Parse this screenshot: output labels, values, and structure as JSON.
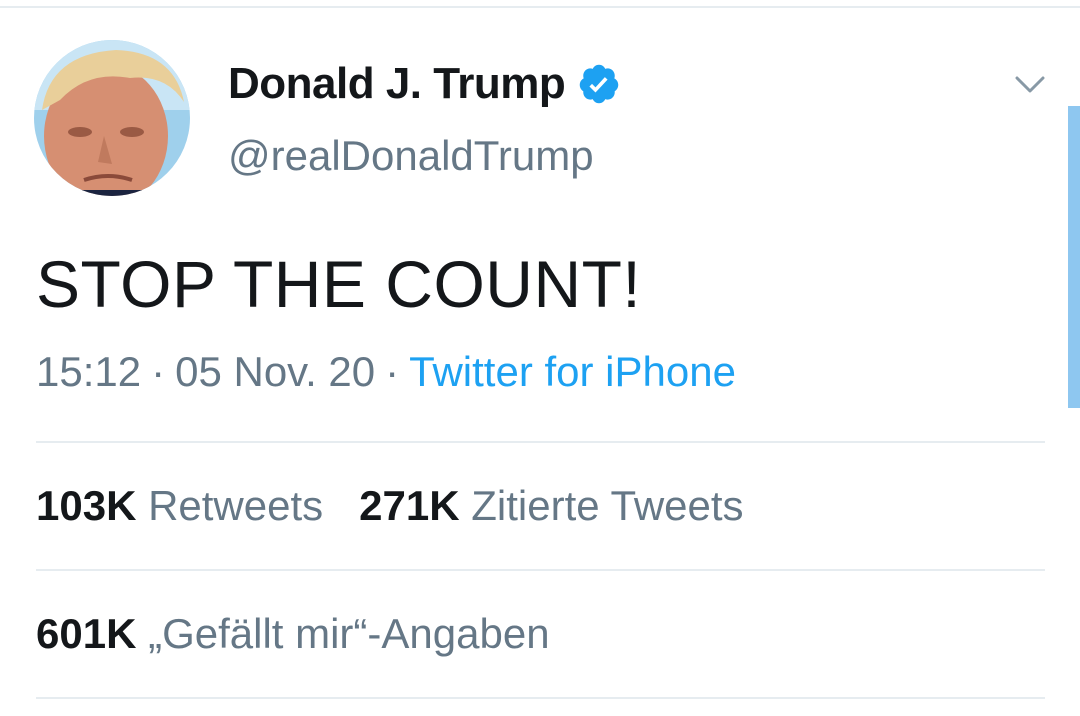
{
  "tweet": {
    "author": {
      "display_name": "Donald J. Trump",
      "handle": "@realDonaldTrump",
      "verified": true,
      "avatar_icon": "user-avatar"
    },
    "text": "STOP THE COUNT!",
    "time": "15:12",
    "date": "05 Nov. 20",
    "separator": "·",
    "source": "Twitter for iPhone",
    "stats": {
      "retweets_count": "103K",
      "retweets_label": "Retweets",
      "quotes_count": "271K",
      "quotes_label": "Zitierte Tweets",
      "likes_count": "601K",
      "likes_label": "„Gefällt mir“-Angaben"
    }
  },
  "icons": {
    "verified": "verified-badge-icon",
    "more": "chevron-down-icon"
  },
  "colors": {
    "text_primary": "#14171a",
    "text_secondary": "#657786",
    "link": "#1da1f2",
    "verified": "#1da1f2",
    "divider": "#e6ecf0"
  }
}
